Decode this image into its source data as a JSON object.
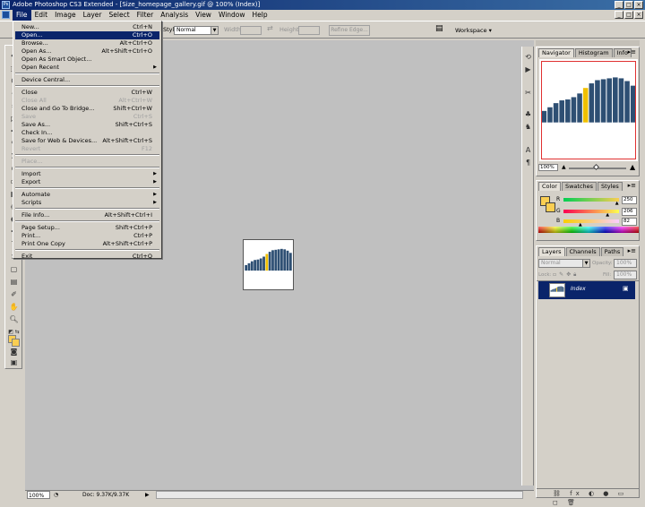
{
  "window": {
    "app_icon_text": "Ps",
    "title": "Adobe Photoshop CS3 Extended - [Size_homepage_gallery.gif @ 100% (Index)]",
    "controls": {
      "minimize": "_",
      "maximize": "□",
      "close": "×"
    }
  },
  "menubar": {
    "items": [
      "File",
      "Edit",
      "Image",
      "Layer",
      "Select",
      "Filter",
      "Analysis",
      "View",
      "Window",
      "Help"
    ],
    "active": "File"
  },
  "options_bar": {
    "style_label": "Style:",
    "style_value": "Normal",
    "width_label": "Width:",
    "height_label": "Height:",
    "refine_edge_label": "Refine Edge...",
    "workspace_label": "Workspace"
  },
  "file_menu": {
    "items": [
      {
        "label": "New...",
        "shortcut": "Ctrl+N"
      },
      {
        "label": "Open...",
        "shortcut": "Ctrl+O",
        "highlighted": true
      },
      {
        "label": "Browse...",
        "shortcut": "Alt+Ctrl+O"
      },
      {
        "label": "Open As...",
        "shortcut": "Alt+Shift+Ctrl+O"
      },
      {
        "label": "Open As Smart Object..."
      },
      {
        "label": "Open Recent",
        "submenu": true
      },
      {
        "separator": true
      },
      {
        "label": "Device Central..."
      },
      {
        "separator": true
      },
      {
        "label": "Close",
        "shortcut": "Ctrl+W"
      },
      {
        "label": "Close All",
        "shortcut": "Alt+Ctrl+W",
        "disabled": true
      },
      {
        "label": "Close and Go To Bridge...",
        "shortcut": "Shift+Ctrl+W"
      },
      {
        "label": "Save",
        "shortcut": "Ctrl+S",
        "disabled": true
      },
      {
        "label": "Save As...",
        "shortcut": "Shift+Ctrl+S"
      },
      {
        "label": "Check In..."
      },
      {
        "label": "Save for Web & Devices...",
        "shortcut": "Alt+Shift+Ctrl+S"
      },
      {
        "label": "Revert",
        "shortcut": "F12",
        "disabled": true
      },
      {
        "separator": true
      },
      {
        "label": "Place...",
        "disabled": true
      },
      {
        "separator": true
      },
      {
        "label": "Import",
        "submenu": true
      },
      {
        "label": "Export",
        "submenu": true
      },
      {
        "separator": true
      },
      {
        "label": "Automate",
        "submenu": true
      },
      {
        "label": "Scripts",
        "submenu": true
      },
      {
        "separator": true
      },
      {
        "label": "File Info...",
        "shortcut": "Alt+Shift+Ctrl+I"
      },
      {
        "separator": true
      },
      {
        "label": "Page Setup...",
        "shortcut": "Shift+Ctrl+P"
      },
      {
        "label": "Print...",
        "shortcut": "Ctrl+P"
      },
      {
        "label": "Print One Copy",
        "shortcut": "Alt+Shift+Ctrl+P"
      },
      {
        "separator": true
      },
      {
        "label": "Exit",
        "shortcut": "Ctrl+Q"
      }
    ]
  },
  "navigator_panel": {
    "tabs": [
      "Navigator",
      "Histogram",
      "Info"
    ],
    "zoom": "100%"
  },
  "color_panel": {
    "tabs": [
      "Color",
      "Swatches",
      "Styles"
    ],
    "r_label": "R",
    "g_label": "G",
    "b_label": "B",
    "r": "250",
    "g": "206",
    "b": "82",
    "r_fraction": 0.98,
    "g_fraction": 0.81,
    "b_fraction": 0.32
  },
  "layers_panel": {
    "tabs": [
      "Layers",
      "Channels",
      "Paths"
    ],
    "blend_mode": "Normal",
    "opacity_label": "Opacity:",
    "opacity": "100%",
    "lock_label": "Lock:",
    "fill_label": "Fill:",
    "fill": "100%",
    "layer_name": "Index",
    "footer_icons": "⛓ fx ◐ ● ▭ ◻ 🗑"
  },
  "statusbar": {
    "zoom": "100%",
    "doc_info": "Doc: 9.37K/9.37K"
  },
  "image_content": {
    "bar_color": "#2e4f73",
    "highlight_color": "#f0c000",
    "bar_heights": [
      0.25,
      0.33,
      0.42,
      0.48,
      0.5,
      0.55,
      0.63,
      0.75,
      0.85,
      0.92,
      0.94,
      0.96,
      0.98,
      0.96,
      0.9,
      0.8
    ],
    "highlight_index": 7
  }
}
